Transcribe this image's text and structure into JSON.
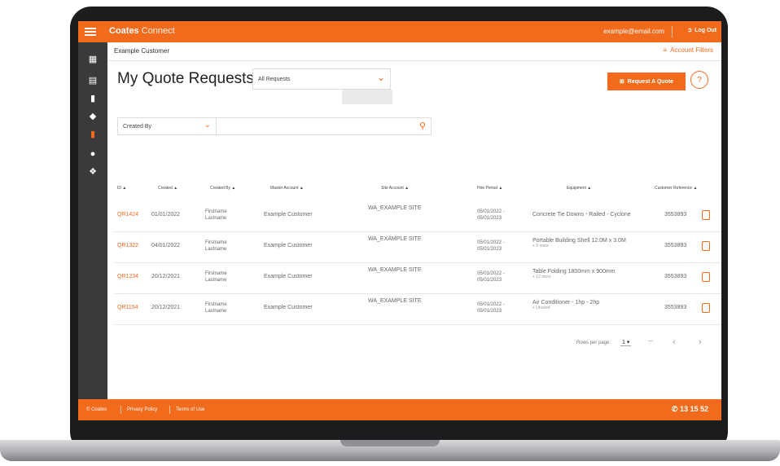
{
  "app": {
    "brand_bold": "Coates",
    "brand_light": "Connect"
  },
  "topbar": {
    "email": "example@email.com",
    "logout": "Log Out"
  },
  "customer": {
    "name": "Example Customer",
    "account_filters": "Account Filters"
  },
  "page": {
    "title": "My Quote Requests",
    "requests_select": "All Requests",
    "request_quote": "Request A Quote"
  },
  "filter": {
    "field": "Created By",
    "placeholder": ""
  },
  "table": {
    "headers": [
      "ID",
      "Created",
      "Created By",
      "Master Account",
      "Site Account",
      "Hire Period",
      "Equipment",
      "Customer Reference"
    ],
    "rows": [
      {
        "id": "QR1424",
        "created": "01/01/2022",
        "by1": "Firstname",
        "by2": "Lastname",
        "master": "Example Customer",
        "site": "WA_EXAMPLE SITE",
        "hire1": "05/01/2022 -",
        "hire2": "05/01/2023",
        "equip": "Concrete Tie Downs - Railed - Cyclone",
        "equip_sub": "",
        "ref": "3553893"
      },
      {
        "id": "QR1322",
        "created": "04/01/2022",
        "by1": "Firstname",
        "by2": "Lastname",
        "master": "Example Customer",
        "site": "WA_EXAMPLE SITE",
        "hire1": "05/01/2022 -",
        "hire2": "05/01/2023",
        "equip": "Portable Building Shell 12.0M x 3.0M",
        "equip_sub": "+ 5 more",
        "ref": "3553893"
      },
      {
        "id": "QR1234",
        "created": "20/12/2021",
        "by1": "Firstname",
        "by2": "Lastname",
        "master": "Example Customer",
        "site": "WA_EXAMPLE SITE",
        "hire1": "05/01/2022 -",
        "hire2": "05/01/2023",
        "equip": "Table Folding 1800mm x 900mm",
        "equip_sub": "+ 12 more",
        "ref": "3553893"
      },
      {
        "id": "QR1154",
        "created": "20/12/2021",
        "by1": "Firstname",
        "by2": "Lastname",
        "master": "Example Customer",
        "site": "WA_EXAMPLE SITE",
        "hire1": "05/01/2022 -",
        "hire2": "05/01/2023",
        "equip": "Air Conditioner - 1hp - 2hp",
        "equip_sub": "+ Unused",
        "ref": "3553893"
      }
    ]
  },
  "pager": {
    "label": "Rows per page:",
    "value": "1",
    "separator": "—"
  },
  "footer": {
    "copyright": "© Coates",
    "privacy": "Privacy Policy",
    "terms": "Terms of Use",
    "phone": "13 15 52"
  },
  "colors": {
    "accent": "#f26b1d",
    "sidebar": "#3a3a3c"
  }
}
